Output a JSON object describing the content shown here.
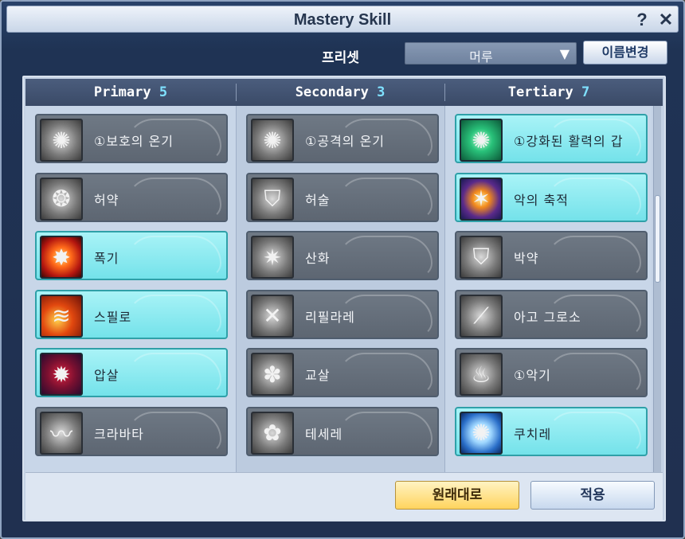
{
  "window": {
    "title": "Mastery Skill",
    "help_glyph": "?",
    "close_glyph": "✕"
  },
  "preset": {
    "label": "프리셋",
    "selected": "머루",
    "arrow": "▼",
    "rename_label": "이름변경"
  },
  "columns": [
    {
      "name": "Primary",
      "count": "5"
    },
    {
      "name": "Secondary",
      "count": "3"
    },
    {
      "name": "Tertiary",
      "count": "7"
    }
  ],
  "skills": {
    "primary": [
      {
        "label": "①보호의 온기",
        "active": false,
        "icon": "snowflake-icon",
        "glyph": "✺"
      },
      {
        "label": "허약",
        "active": false,
        "icon": "bubbles-icon",
        "glyph": "❂"
      },
      {
        "label": "폭기",
        "active": true,
        "icon": "explosion-icon",
        "glyph": "✸"
      },
      {
        "label": "스필로",
        "active": true,
        "icon": "fire-slash-icon",
        "glyph": "≋"
      },
      {
        "label": "압살",
        "active": true,
        "icon": "crush-icon",
        "glyph": "✹"
      },
      {
        "label": "크라바타",
        "active": false,
        "icon": "wind-icon",
        "glyph": "〰"
      }
    ],
    "secondary": [
      {
        "label": "①공격의 온기",
        "active": false,
        "icon": "snowflake-icon",
        "glyph": "✺"
      },
      {
        "label": "허술",
        "active": false,
        "icon": "broken-shield-icon",
        "glyph": "⛉"
      },
      {
        "label": "산화",
        "active": false,
        "icon": "burst-icon",
        "glyph": "✷"
      },
      {
        "label": "리필라레",
        "active": false,
        "icon": "crossed-blades-icon",
        "glyph": "✕"
      },
      {
        "label": "교살",
        "active": false,
        "icon": "bind-icon",
        "glyph": "✽"
      },
      {
        "label": "테세레",
        "active": false,
        "icon": "knot-icon",
        "glyph": "✿"
      }
    ],
    "tertiary": [
      {
        "label": "①강화된 활력의 갑",
        "active": true,
        "icon": "snowflake-icon",
        "glyph": "✺"
      },
      {
        "label": "악의 축적",
        "active": true,
        "icon": "spark-icon",
        "glyph": "✶"
      },
      {
        "label": "박약",
        "active": false,
        "icon": "broken-shield-icon",
        "glyph": "⛉"
      },
      {
        "label": "아고 그로소",
        "active": false,
        "icon": "spear-icon",
        "glyph": "⟋"
      },
      {
        "label": "①악기",
        "active": false,
        "icon": "aura-icon",
        "glyph": "♨"
      },
      {
        "label": "쿠치레",
        "active": true,
        "icon": "ice-burst-icon",
        "glyph": "✺"
      }
    ]
  },
  "footer": {
    "reset_label": "원래대로",
    "apply_label": "적용"
  },
  "colors": {
    "active_tile": "#74e2ea",
    "inactive_tile": "#6f7985",
    "count_accent": "#7fe1ff",
    "reset_button": "#ffd45e"
  }
}
